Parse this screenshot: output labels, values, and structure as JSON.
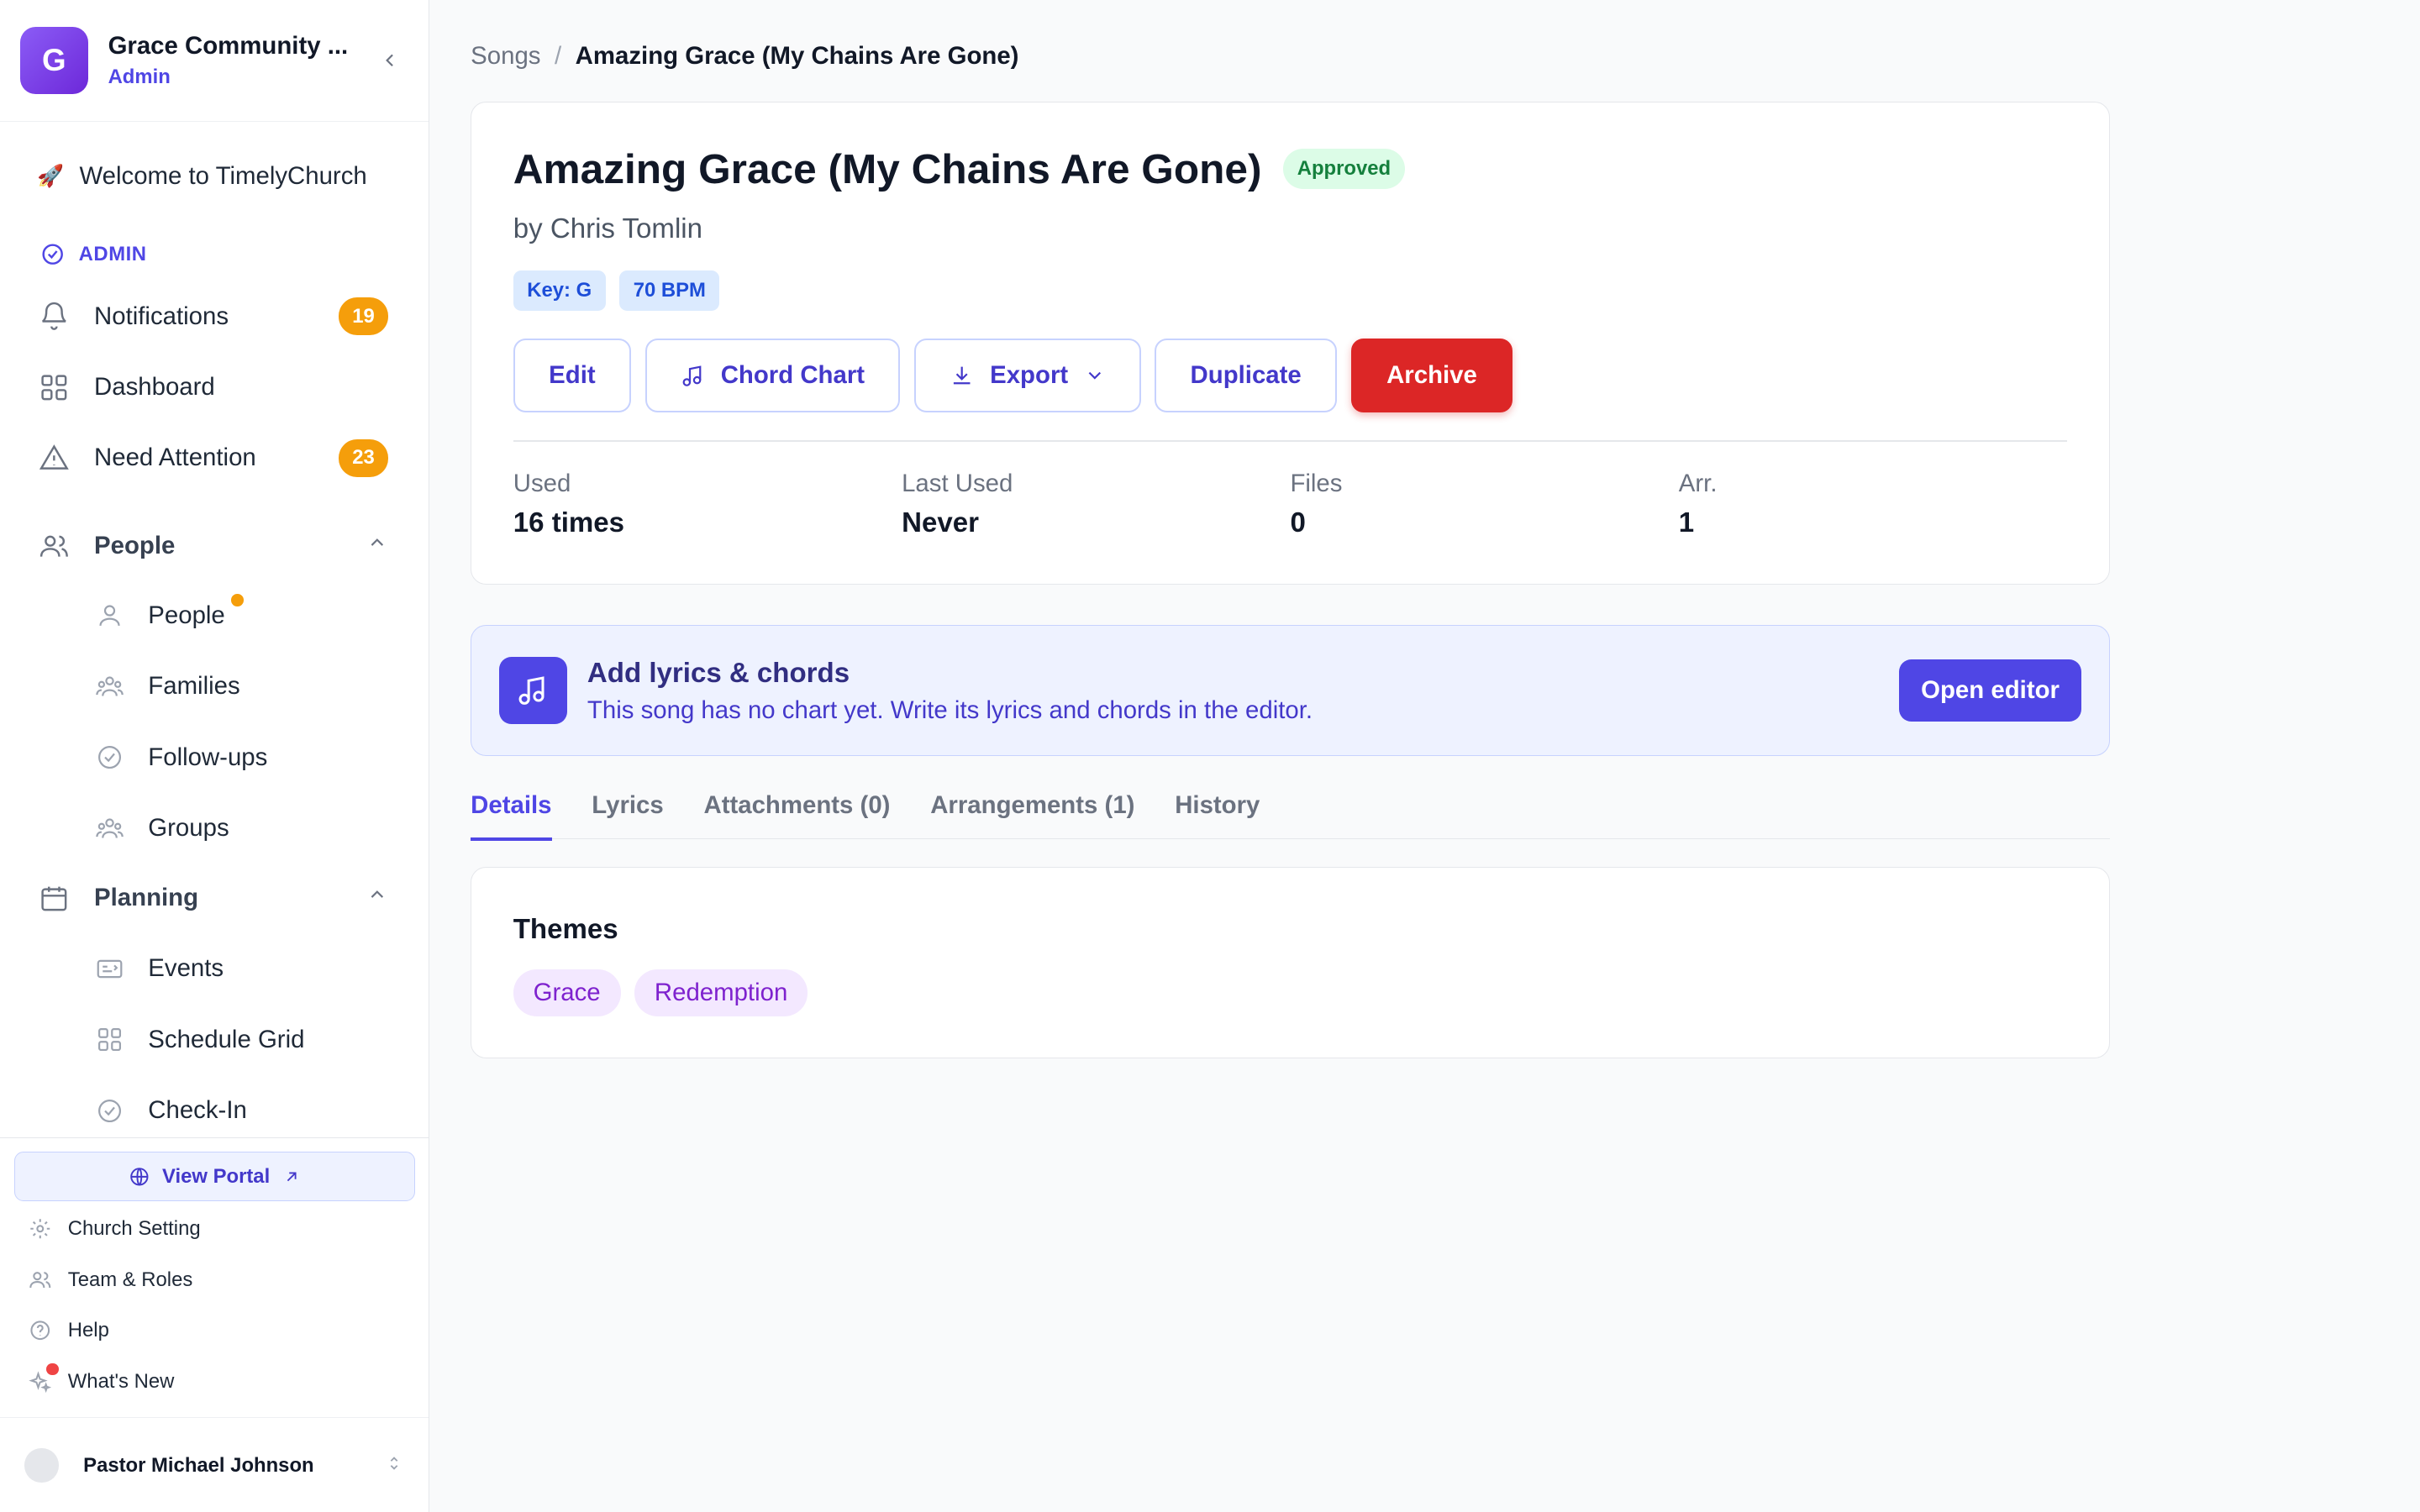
{
  "org": {
    "initial": "G",
    "name": "Grace Community ...",
    "role": "Admin"
  },
  "nav": {
    "welcome": "Welcome to TimelyChurch",
    "section_label": "ADMIN",
    "notifications": {
      "label": "Notifications",
      "count": "19"
    },
    "dashboard": "Dashboard",
    "need_attention": {
      "label": "Need Attention",
      "count": "23"
    },
    "people_group": "People",
    "people_items": [
      "People",
      "Families",
      "Follow-ups",
      "Groups"
    ],
    "planning_group": "Planning",
    "planning_items": [
      "Events",
      "Schedule Grid",
      "Check-In"
    ]
  },
  "footer": {
    "view_portal": "View Portal",
    "items": [
      "Church Setting",
      "Team & Roles",
      "Help",
      "What's New"
    ],
    "user_name": "Pastor Michael Johnson"
  },
  "breadcrumb": {
    "parent": "Songs",
    "separator": "/",
    "current": "Amazing Grace (My Chains Are Gone)"
  },
  "song": {
    "title": "Amazing Grace (My Chains Are Gone)",
    "status": "Approved",
    "artist": "by Chris Tomlin",
    "key": "Key: G",
    "bpm": "70 BPM",
    "actions": {
      "edit": "Edit",
      "chord_chart": "Chord Chart",
      "export": "Export",
      "duplicate": "Duplicate",
      "archive": "Archive"
    },
    "stats": [
      {
        "label": "Used",
        "value": "16 times"
      },
      {
        "label": "Last Used",
        "value": "Never"
      },
      {
        "label": "Files",
        "value": "0"
      },
      {
        "label": "Arr.",
        "value": "1"
      }
    ]
  },
  "banner": {
    "title": "Add lyrics & chords",
    "description": "This song has no chart yet. Write its lyrics and chords in the editor.",
    "button": "Open editor"
  },
  "tabs": [
    "Details",
    "Lyrics",
    "Attachments (0)",
    "Arrangements (1)",
    "History"
  ],
  "active_tab": "Details",
  "themes": {
    "title": "Themes",
    "items": [
      "Grace",
      "Redemption"
    ]
  },
  "colors": {
    "accent": "#4f46e5",
    "danger": "#dc2626",
    "badge": "#f59e0b",
    "approved": "#15803d",
    "theme_chip": "#7e22ce"
  }
}
